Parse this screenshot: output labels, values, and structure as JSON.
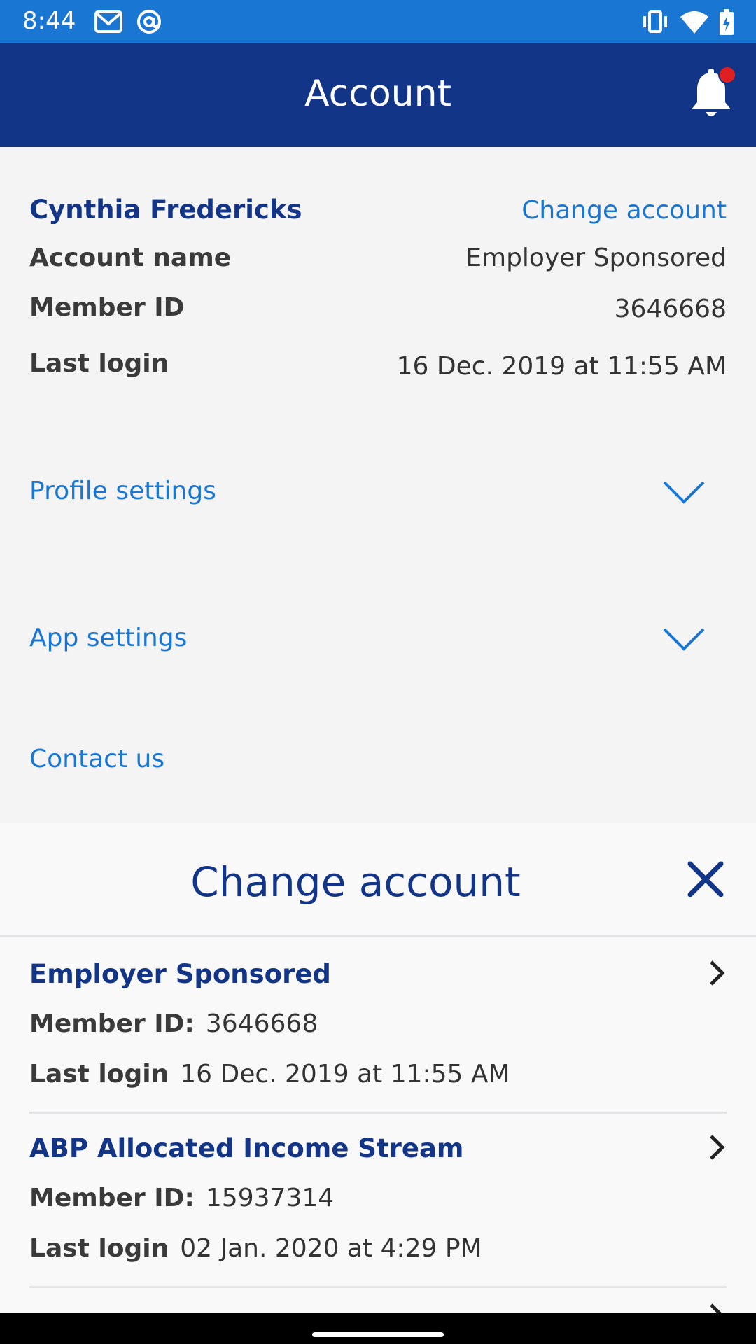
{
  "status_bar": {
    "time": "8:44",
    "left_icons": [
      "gmail-icon",
      "at-sign-icon"
    ],
    "right_icons": [
      "vibrate-icon",
      "wifi-icon",
      "battery-charging-icon"
    ]
  },
  "header": {
    "title": "Account",
    "bell_icon": "bell-icon",
    "has_notification_dot": true
  },
  "account": {
    "name": "Cynthia Fredericks",
    "change_account_label": "Change account",
    "rows": [
      {
        "label": "Account name",
        "value": "Employer Sponsored"
      },
      {
        "label": "Member ID",
        "value": "3646668"
      },
      {
        "label": "Last login",
        "value": "16 Dec. 2019 at 11:55 AM"
      }
    ]
  },
  "sections": [
    {
      "label": "Profile settings",
      "icon": "chevron-down-icon"
    },
    {
      "label": "App settings",
      "icon": "chevron-down-icon"
    },
    {
      "label": "Contact us"
    }
  ],
  "sheet": {
    "title": "Change account",
    "close_icon": "close-icon",
    "accounts": [
      {
        "title": "Employer Sponsored",
        "member_id_label": "Member ID:",
        "member_id": "3646668",
        "last_login_label": "Last login",
        "last_login": "16 Dec. 2019 at 11:55 AM"
      },
      {
        "title": "ABP Allocated Income Stream",
        "member_id_label": "Member ID:",
        "member_id": "15937314",
        "last_login_label": "Last login",
        "last_login": "02 Jan. 2020 at 4:29 PM"
      }
    ]
  },
  "colors": {
    "status_bar": "#1976d2",
    "header": "#133587",
    "link": "#1976d2",
    "title_text": "#133587",
    "notification_dot": "#e02020"
  }
}
